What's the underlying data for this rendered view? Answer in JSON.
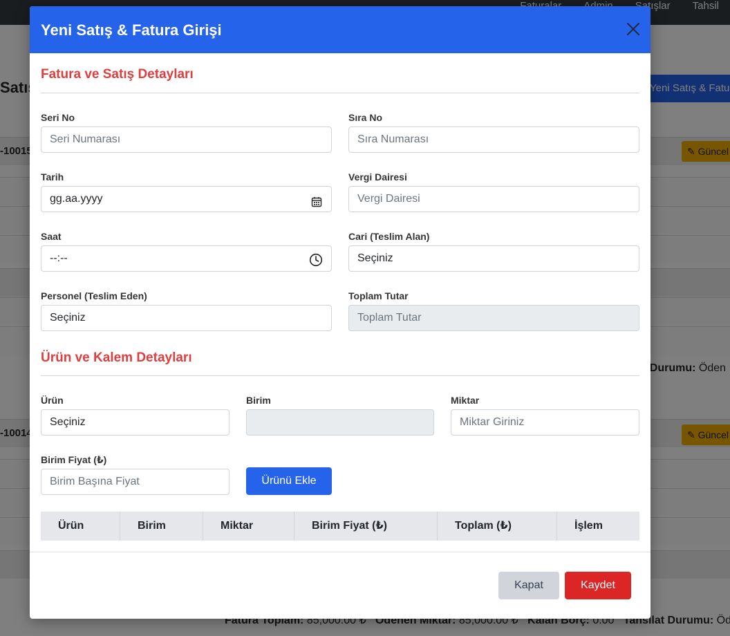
{
  "background": {
    "nav": [
      "Faturalar",
      "Admin",
      "Satışlar",
      "Tahsil"
    ],
    "page_title": "Satış İşl",
    "new_button": "Yeni Satış & Fatura",
    "rows": [
      {
        "id": "-10015",
        "edit": "Güncel"
      },
      {
        "id": "-10014",
        "edit": "Güncel"
      }
    ],
    "status_label": "t Durumu:",
    "status_value": "Öden",
    "footer": {
      "total_label": "Fatura Toplam:",
      "total_value": "85,000.00 ₺",
      "paid_label": "Ödenen Miktar:",
      "paid_value": "85,000.00 ₺",
      "debt_label": "Kalan Borç:",
      "debt_value": "0.00",
      "status_label": "Tahsilat Durumu:",
      "status_value": "Öden"
    }
  },
  "modal": {
    "title": "Yeni Satış & Fatura Girişi",
    "invoice_section_title": "Fatura ve Satış Detayları",
    "fields": {
      "seri_no": {
        "label": "Seri No",
        "placeholder": "Seri Numarası"
      },
      "sira_no": {
        "label": "Sıra No",
        "placeholder": "Sıra Numarası"
      },
      "tarih": {
        "label": "Tarih",
        "value": "gg.aa.yyyy"
      },
      "vergi_dairesi": {
        "label": "Vergi Dairesi",
        "placeholder": "Vergi Dairesi"
      },
      "saat": {
        "label": "Saat",
        "value": "--:--"
      },
      "cari": {
        "label": "Cari (Teslim Alan)",
        "value": "Seçiniz"
      },
      "personel": {
        "label": "Personel (Teslim Eden)",
        "value": "Seçiniz"
      },
      "toplam_tutar": {
        "label": "Toplam Tutar",
        "placeholder": "Toplam Tutar"
      }
    },
    "product_section_title": "Ürün ve Kalem Detayları",
    "product_fields": {
      "urun": {
        "label": "Ürün",
        "value": "Seçiniz"
      },
      "birim": {
        "label": "Birim",
        "value": ""
      },
      "miktar": {
        "label": "Miktar",
        "placeholder": "Miktar Giriniz"
      },
      "birim_fiyat": {
        "label": "Birim Fiyat (₺)",
        "placeholder": "Birim Başına Fiyat"
      }
    },
    "add_button": "Ürünü Ekle",
    "table_headers": [
      "Ürün",
      "Birim",
      "Miktar",
      "Birim Fiyat (₺)",
      "Toplam (₺)",
      "İşlem"
    ],
    "close_button": "Kapat",
    "save_button": "Kaydet"
  }
}
